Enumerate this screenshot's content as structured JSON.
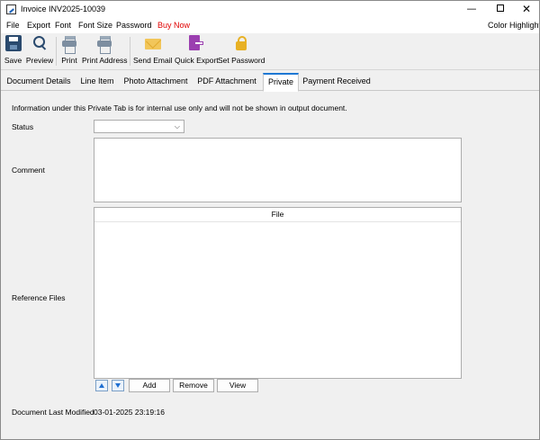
{
  "window": {
    "title": "Invoice INV2025-10039",
    "minimize": "—",
    "close": "✕"
  },
  "menu": {
    "items": [
      "File",
      "Export",
      "Font",
      "Font Size",
      "Password",
      "Buy Now"
    ],
    "right": "Color Highlight",
    "buy_color": "#e00000"
  },
  "toolbar": {
    "save": "Save",
    "preview": "Preview",
    "print": "Print",
    "print_address": "Print Address",
    "send_email": "Send Email",
    "quick_export": "Quick Export",
    "set_password": "Set Password"
  },
  "tabs": [
    {
      "label": "Document Details",
      "active": false
    },
    {
      "label": "Line Item",
      "active": false
    },
    {
      "label": "Photo Attachment",
      "active": false
    },
    {
      "label": "PDF Attachment",
      "active": false
    },
    {
      "label": "Private",
      "active": true
    },
    {
      "label": "Payment Received",
      "active": false
    }
  ],
  "private": {
    "info": "Information under this Private Tab is for internal use only and will not be shown in output document.",
    "status_label": "Status",
    "status_value": "",
    "comment_label": "Comment",
    "comment_value": "",
    "reference_label": "Reference Files",
    "file_column": "File",
    "files": [],
    "add": "Add",
    "remove": "Remove",
    "view": "View",
    "last_modified_label": "Document Last Modified",
    "last_modified_value": "03-01-2025 23:19:16"
  },
  "colors": {
    "accent": "#1e78d4"
  }
}
